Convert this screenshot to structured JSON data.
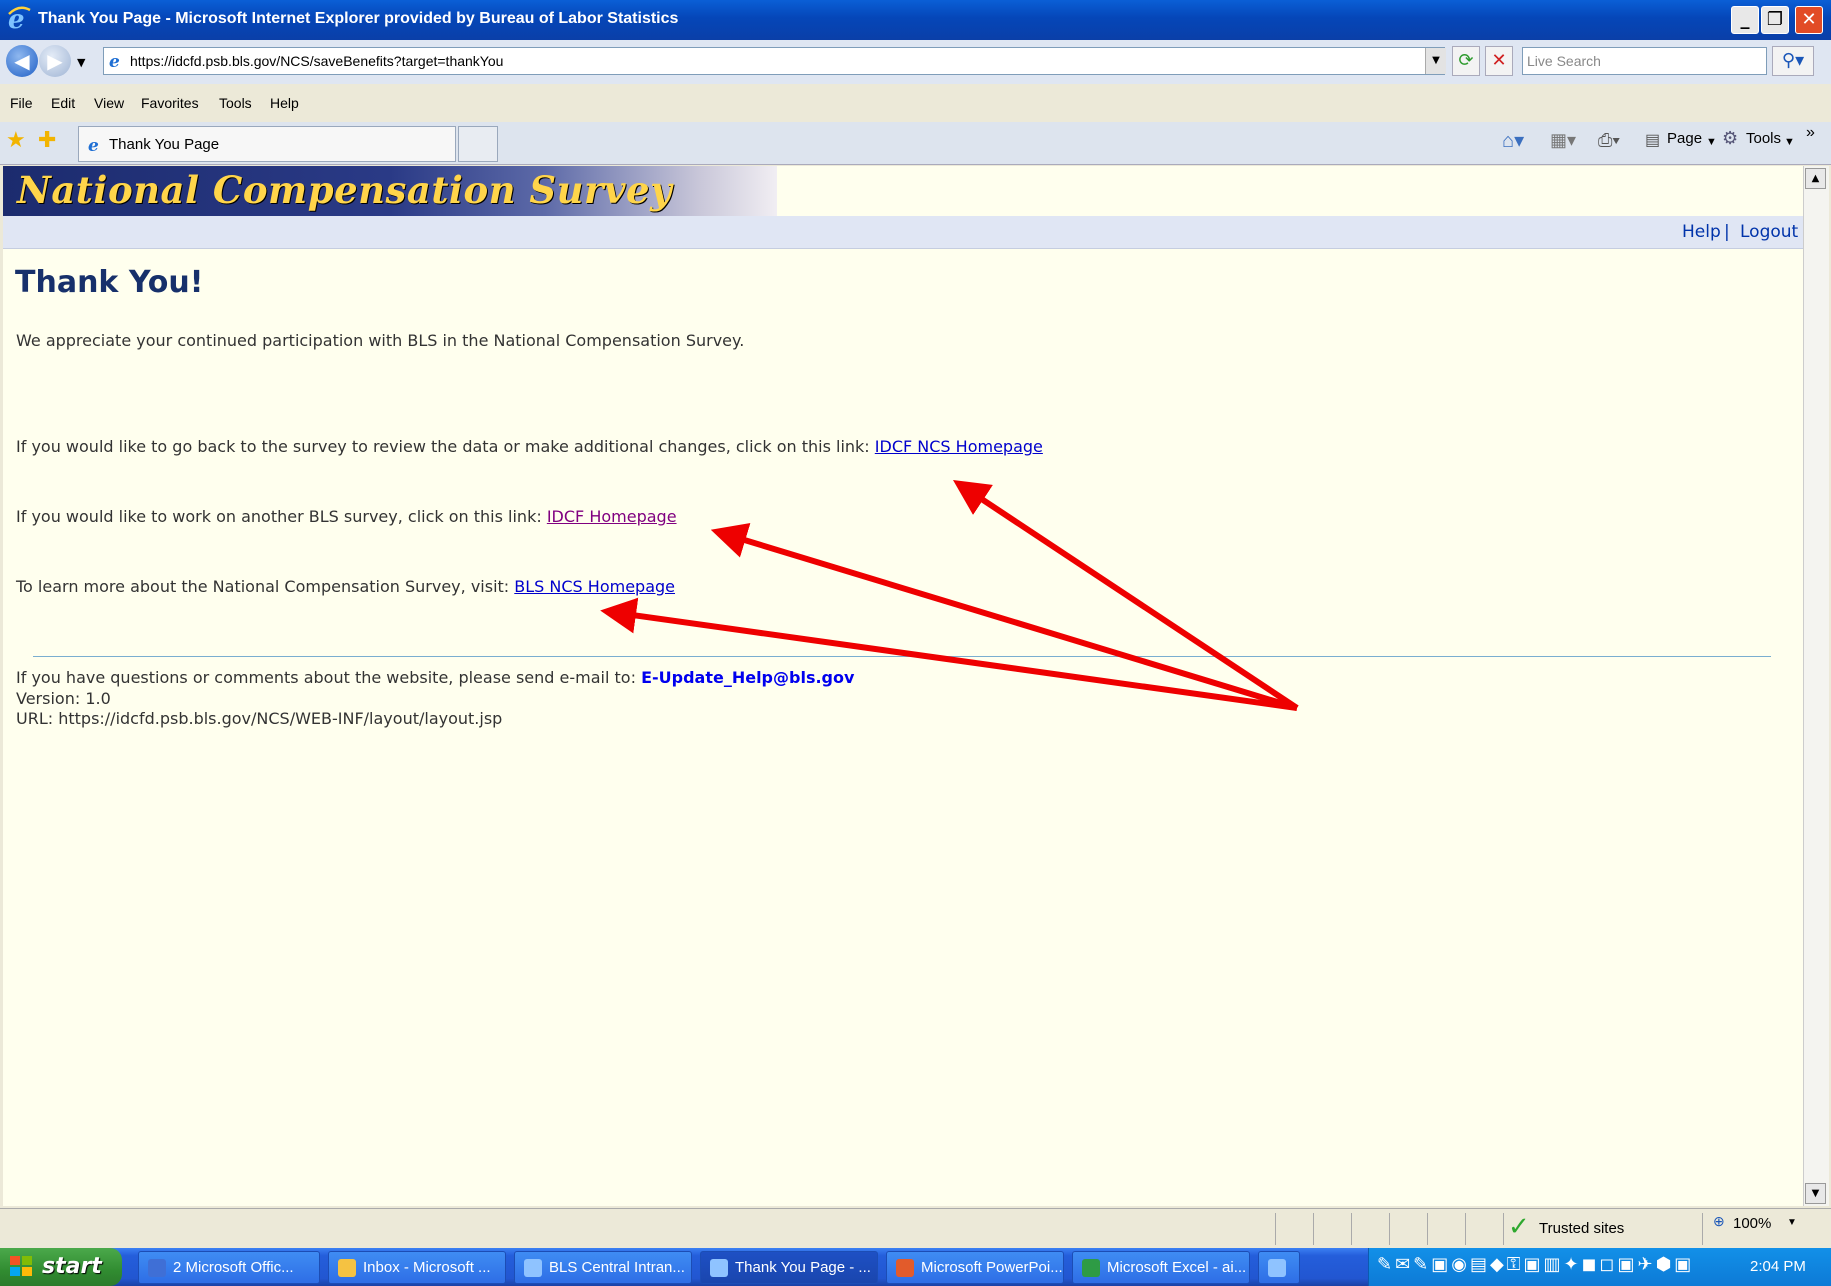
{
  "window": {
    "title": "Thank You Page - Microsoft Internet Explorer provided by Bureau of Labor Statistics"
  },
  "address": {
    "url": "https://idcfd.psb.bls.gov/NCS/saveBenefits?target=thankYou",
    "search_placeholder": "Live Search"
  },
  "menu": [
    "File",
    "Edit",
    "View",
    "Favorites",
    "Tools",
    "Help"
  ],
  "tab": {
    "label": "Thank You Page"
  },
  "toolbar": {
    "page_label": "Page",
    "tools_label": "Tools"
  },
  "page": {
    "banner_title": "National Compensation Survey",
    "help_link": "Help",
    "separator": "|",
    "logout_link": "Logout",
    "heading": "Thank You!",
    "intro": "We appreciate your continued participation with BLS in the National Compensation Survey.",
    "line1_text": "If you would like to go back to the survey to review the data or make additional changes, click on this link:",
    "line1_link": "IDCF NCS Homepage",
    "line2_text": "If you would like to work on another BLS survey, click on this link:",
    "line2_link": "IDCF Homepage",
    "line3_text": "To learn more about the National Compensation Survey, visit:",
    "line3_link": "BLS NCS Homepage",
    "footer_text": "If you have questions or comments about the website, please send e-mail to:",
    "footer_email": "E-Update_Help@bls.gov",
    "version": "Version: 1.0",
    "url_line": "URL: https://idcfd.psb.bls.gov/NCS/WEB-INF/layout/layout.jsp"
  },
  "annotation": {
    "arrow_color": "#ee0000"
  },
  "status": {
    "zone": "Trusted sites",
    "zoom": "100%"
  },
  "taskbar": {
    "start": "start",
    "items": [
      "2 Microsoft Offic...",
      "Inbox - Microsoft ...",
      "BLS Central Intran...",
      "Thank You Page - ...",
      "Microsoft PowerPoi...",
      "Microsoft Excel - ai..."
    ],
    "clock": "2:04 PM"
  }
}
